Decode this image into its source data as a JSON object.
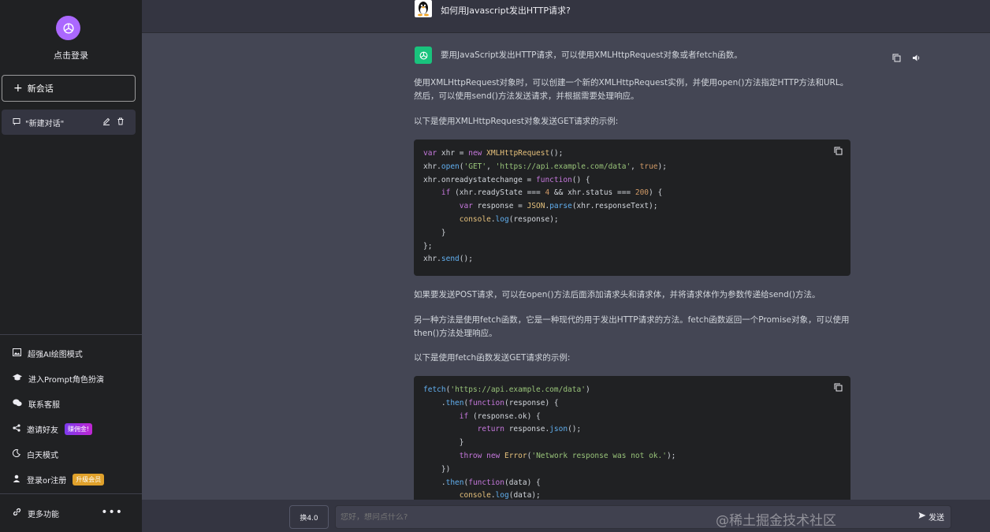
{
  "sidebar": {
    "login_label": "点击登录",
    "new_chat_label": "新会话",
    "conversation_label": "\"新建对话\"",
    "menu": [
      {
        "label": "超强AI绘图模式",
        "icon": "image-icon"
      },
      {
        "label": "进入Prompt角色扮演",
        "icon": "graduation-cap-icon"
      },
      {
        "label": "联系客服",
        "icon": "wechat-icon"
      },
      {
        "label": "邀请好友",
        "icon": "share-icon",
        "badge": "赚佣金!"
      },
      {
        "label": "白天模式",
        "icon": "moon-icon"
      },
      {
        "label": "登录or注册",
        "icon": "user-icon",
        "badge": "升级会员"
      }
    ],
    "more_label": "更多功能"
  },
  "chat": {
    "user_message": "如何用Javascript发出HTTP请求?",
    "answer_intro": "要用JavaScript发出HTTP请求，可以使用XMLHttpRequest对象或者fetch函数。",
    "para1": "使用XMLHttpRequest对象时，可以创建一个新的XMLHttpRequest实例，并使用open()方法指定HTTP方法和URL。然后，可以使用send()方法发送请求，并根据需要处理响应。",
    "para2": "以下是使用XMLHttpRequest对象发送GET请求的示例:",
    "para3": "如果要发送POST请求，可以在open()方法后面添加请求头和请求体，并将请求体作为参数传递给send()方法。",
    "para4": "另一种方法是使用fetch函数，它是一种现代的用于发出HTTP请求的方法。fetch函数返回一个Promise对象，可以使用then()方法处理响应。",
    "para5": "以下是使用fetch函数发送GET请求的示例:"
  },
  "input": {
    "model_label": "换4.0",
    "placeholder": "您好，想问点什么?",
    "send_label": "发送"
  },
  "watermark": "@稀土掘金技术社区",
  "colors": {
    "sidebar_bg": "#202123",
    "main_bg": "#343541",
    "assistant_bg": "#444654",
    "code_bg": "#202123",
    "bot_avatar": "#19c37d",
    "logo": "#ab68ff"
  }
}
